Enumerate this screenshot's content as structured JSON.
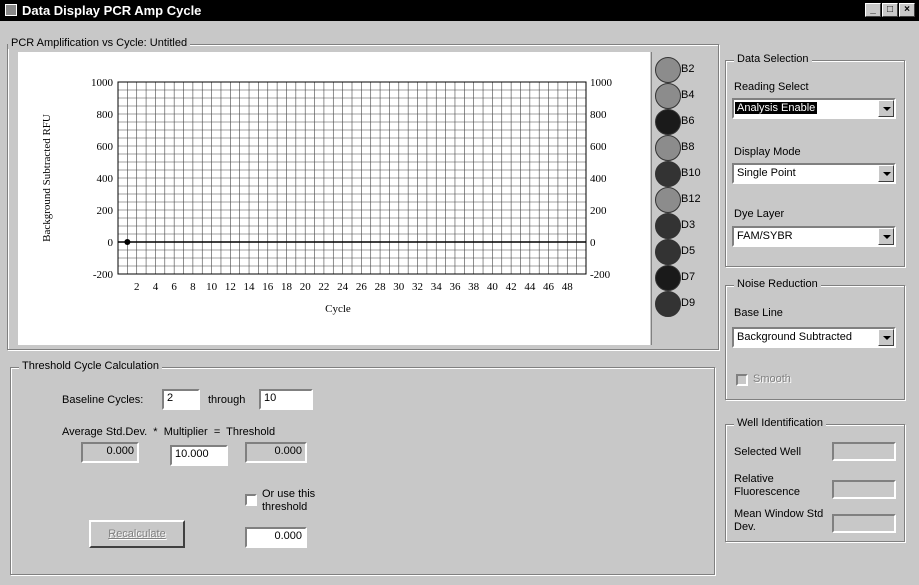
{
  "window": {
    "title": "Data Display PCR Amp Cycle",
    "min_label": "_",
    "max_label": "□",
    "close_label": "×"
  },
  "plot_frame": {
    "title": "PCR Amplification vs Cycle: Untitled"
  },
  "chart_data": {
    "type": "scatter",
    "xlabel": "Cycle",
    "ylabel": "Background Subtracted RFU",
    "x_ticks": [
      "2",
      "4",
      "6",
      "8",
      "10",
      "12",
      "14",
      "16",
      "18",
      "20",
      "22",
      "24",
      "26",
      "28",
      "30",
      "32",
      "34",
      "36",
      "38",
      "40",
      "42",
      "44",
      "46",
      "48"
    ],
    "y_ticks": [
      "1000",
      "800",
      "600",
      "400",
      "200",
      "0",
      "-200"
    ],
    "xlim": [
      0,
      50
    ],
    "ylim": [
      -200,
      1000
    ],
    "grid": true,
    "series": [
      {
        "x": [
          1
        ],
        "y": [
          0
        ]
      }
    ]
  },
  "wells": [
    {
      "label": "B2",
      "color": "#8c8c8c"
    },
    {
      "label": "B4",
      "color": "#8c8c8c"
    },
    {
      "label": "B6",
      "color": "#1a1a1a"
    },
    {
      "label": "B8",
      "color": "#8c8c8c"
    },
    {
      "label": "B10",
      "color": "#333333"
    },
    {
      "label": "B12",
      "color": "#8c8c8c"
    },
    {
      "label": "D3",
      "color": "#333333"
    },
    {
      "label": "D5",
      "color": "#333333"
    },
    {
      "label": "D7",
      "color": "#1a1a1a"
    },
    {
      "label": "D9",
      "color": "#333333"
    }
  ],
  "data_selection": {
    "title": "Data Selection",
    "reading_select_label": "Reading Select",
    "reading_select_value": "Analysis Enable",
    "display_mode_label": "Display Mode",
    "display_mode_value": "Single Point",
    "dye_layer_label": "Dye Layer",
    "dye_layer_value": "FAM/SYBR"
  },
  "noise_reduction": {
    "title": "Noise Reduction",
    "base_line_label": "Base Line",
    "base_line_value": "Background Subtracted",
    "smooth_label": "Smooth"
  },
  "well_identification": {
    "title": "Well Identification",
    "selected_well_label": "Selected Well",
    "relative_fluorescence_label": "Relative Fluorescence",
    "mean_window_label": "Mean Window Std Dev."
  },
  "threshold": {
    "title": "Threshold Cycle Calculation",
    "baseline_cycles_label": "Baseline Cycles:",
    "baseline_from": "2",
    "through_label": "through",
    "baseline_to": "10",
    "formula_label": "Average Std.Dev.  *  Multiplier  =  Threshold",
    "avg_std_dev": "0.000",
    "multiplier": "10.000",
    "threshold_value": "0.000",
    "use_threshold_label": "Or use this threshold",
    "custom_threshold": "0.000",
    "recalculate_label": "Recalculate"
  }
}
